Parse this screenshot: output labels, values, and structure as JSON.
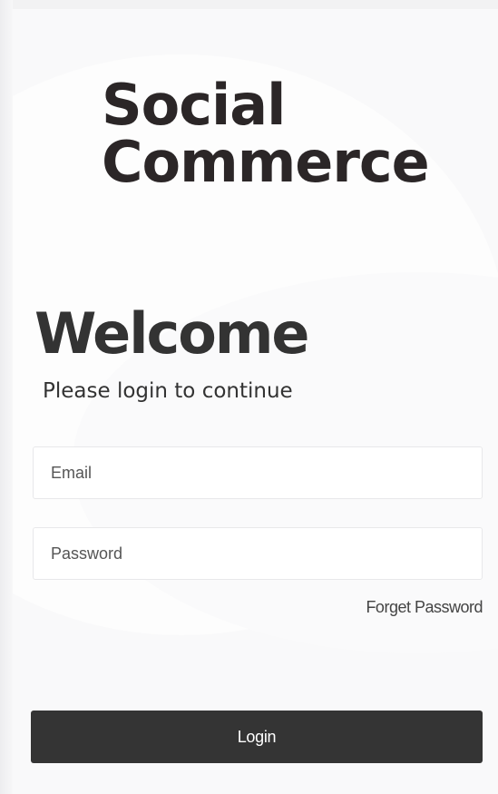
{
  "brand": {
    "line1": "Social",
    "line2": "Commerce"
  },
  "welcome": {
    "title": "Welcome",
    "subtitle": "Please login to continue"
  },
  "form": {
    "email_placeholder": "Email",
    "email_value": "",
    "password_placeholder": "Password",
    "password_value": "",
    "forget_password_label": "Forget Password",
    "login_label": "Login"
  },
  "colors": {
    "brand_text": "#2b2627",
    "heading_text": "#333333",
    "button_background": "#343434",
    "button_text": "#ffffff",
    "field_border": "#e8e8ea",
    "page_background": "#f9f9fa"
  }
}
